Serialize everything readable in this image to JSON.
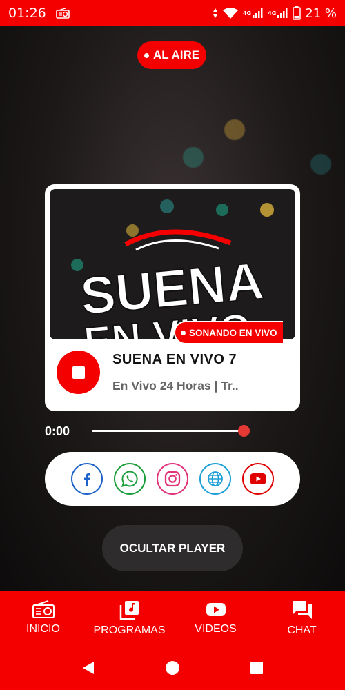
{
  "status_bar": {
    "time": "01:26",
    "network_label_1": "4G",
    "network_label_2": "4G",
    "battery": "21 %"
  },
  "live_badge": {
    "label": "AL AIRE"
  },
  "player": {
    "cover_logo_text_1": "SUENA",
    "cover_logo_text_2": "EN VIVO",
    "playing_badge": "SONANDO EN VIVO",
    "station_name": "SUENA EN VIVO 7",
    "subtitle": "En Vivo 24 Horas | Tr..",
    "elapsed": "0:00",
    "progress": 1.0,
    "accent_color": "#f40000"
  },
  "social": [
    {
      "icon": "facebook-icon",
      "color": "#1e63c9"
    },
    {
      "icon": "whatsapp-icon",
      "color": "#1a9e3a"
    },
    {
      "icon": "instagram-icon",
      "color": "#e0337a"
    },
    {
      "icon": "web-globe-icon",
      "color": "#1e9fd6"
    },
    {
      "icon": "youtube-icon",
      "color": "#e00000"
    }
  ],
  "hide_player": {
    "label": "OCULTAR PLAYER"
  },
  "bottom_nav": {
    "items": [
      {
        "label": "INICIO",
        "icon": "radio-icon"
      },
      {
        "label": "PROGRAMAS",
        "icon": "music-library-icon"
      },
      {
        "label": "VIDEOS",
        "icon": "youtube-icon"
      },
      {
        "label": "CHAT",
        "icon": "chat-icon"
      }
    ]
  }
}
